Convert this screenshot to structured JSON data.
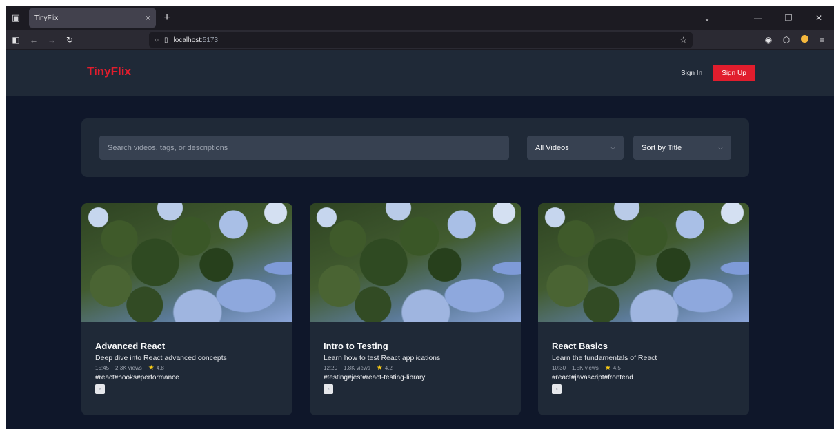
{
  "browser": {
    "tab_title": "TinyFlix",
    "tab_close": "×",
    "new_tab": "+",
    "url_host": "localhost",
    "url_port": ":5173"
  },
  "header": {
    "logo": "TinyFlix",
    "sign_in": "Sign In",
    "sign_up": "Sign Up"
  },
  "search": {
    "placeholder": "Search videos, tags, or descriptions",
    "filter_selected": "All Videos",
    "sort_selected": "Sort by Title"
  },
  "videos": [
    {
      "title": "Advanced React",
      "description": "Deep dive into React advanced concepts",
      "duration": "15:45",
      "views": "2.3K views",
      "rating": "4.8",
      "tags": "#react#hooks#performance"
    },
    {
      "title": "Intro to Testing",
      "description": "Learn how to test React applications",
      "duration": "12:20",
      "views": "1.8K views",
      "rating": "4.2",
      "tags": "#testing#jest#react-testing-library"
    },
    {
      "title": "React Basics",
      "description": "Learn the fundamentals of React",
      "duration": "10:30",
      "views": "1.5K views",
      "rating": "4.5",
      "tags": "#react#javascript#frontend"
    }
  ],
  "colors": {
    "brand": "#e11d2d",
    "page_bg": "#0f172a",
    "panel_bg": "#1f2937",
    "star": "#facc15"
  }
}
